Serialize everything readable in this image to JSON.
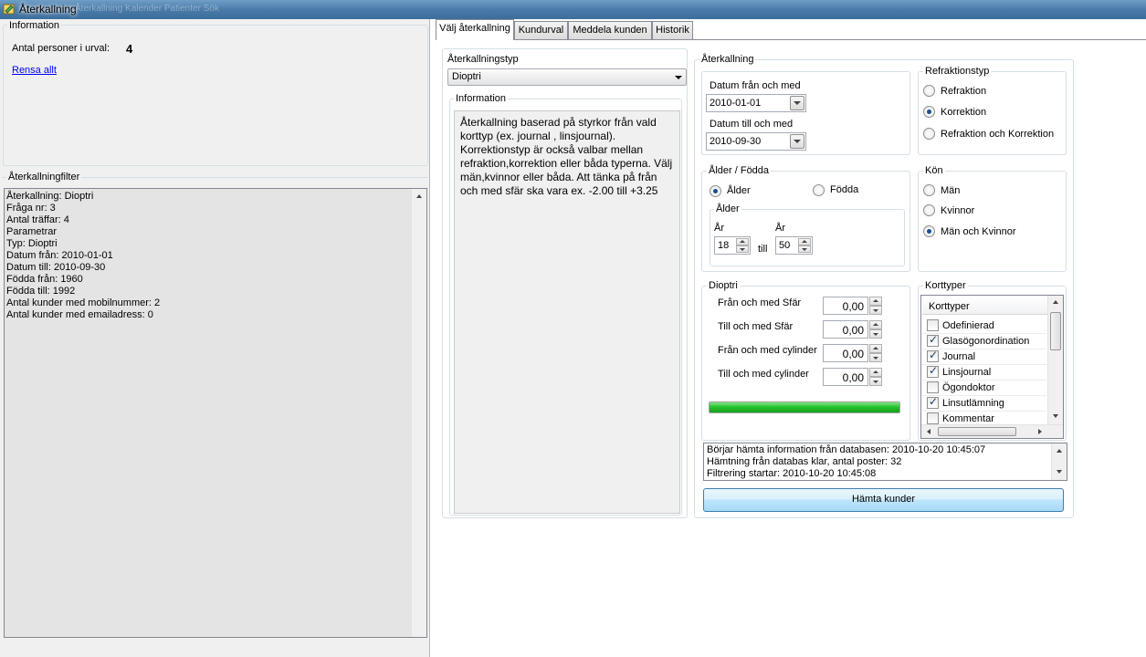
{
  "window": {
    "title": "Återkallning",
    "ghost_title": "Återkallning Kalender Patienter Sök"
  },
  "left": {
    "info_legend": "Information",
    "count_label": "Antal personer i urval:",
    "count_value": "4",
    "clear_link": "Rensa allt",
    "filter_legend": "Återkallningfilter",
    "filter_lines": [
      "Återkallning: Dioptri",
      "Fråga nr: 3",
      "Antal träffar: 4",
      "Parametrar",
      "Typ: Dioptri",
      "Datum från: 2010-01-01",
      "Datum till: 2010-09-30",
      "Födda från: 1960",
      "Födda till: 1992",
      "Antal kunder med mobilnummer: 2",
      "Antal kunder med emailadress: 0"
    ]
  },
  "tabs": [
    "Välj återkallning",
    "Kundurval",
    "Meddela kunden",
    "Historik"
  ],
  "left_col": {
    "type_label": "Återkallningstyp",
    "type_value": "Dioptri",
    "info_legend": "Information",
    "info_text": "Återkallning baserad på styrkor från vald korttyp (ex. journal , linsjournal). Korrektionstyp är också valbar mellan refraktion,korrektion eller båda typerna. Välj män,kvinnor eller båda. Att tänka på från och med sfär ska vara ex. -2.00 till +3.25"
  },
  "recall": {
    "legend": "Återkallning",
    "date_from_label": "Datum från och med",
    "date_from": "2010-01-01",
    "date_to_label": "Datum till och med",
    "date_to": "2010-09-30",
    "refr_legend": "Refraktionstyp",
    "refr_options": [
      "Refraktion",
      "Korrektion",
      "Refraktion och Korrektion"
    ],
    "refr_selected": 1,
    "age_legend": "Ålder / Födda",
    "age_opt1": "Ålder",
    "age_opt2": "Födda",
    "age_inner_legend": "Ålder",
    "year_label1": "År",
    "year_label2": "År",
    "age_from": "18",
    "age_to": "50",
    "till": "till",
    "sex_legend": "Kön",
    "sex_options": [
      "Män",
      "Kvinnor",
      "Män och Kvinnor"
    ],
    "sex_selected": 2,
    "diopt_legend": "Dioptri",
    "diopt_rows": [
      {
        "label": "Från och med Sfär",
        "value": "0,00"
      },
      {
        "label": "Till och med Sfär",
        "value": "0,00"
      },
      {
        "label": "Från och med cylinder",
        "value": "0,00"
      },
      {
        "label": "Till och med cylinder",
        "value": "0,00"
      }
    ],
    "progress_fraction": 1.0,
    "progress_color": "#22c02a",
    "card_legend": "Korttyper",
    "card_header": "Korttyper",
    "cards": [
      {
        "label": "Odefinierad",
        "checked": false
      },
      {
        "label": "Glasögonordination",
        "checked": true
      },
      {
        "label": "Journal",
        "checked": true
      },
      {
        "label": "Linsjournal",
        "checked": true
      },
      {
        "label": "Ögondoktor",
        "checked": false
      },
      {
        "label": "Linsutlämning",
        "checked": true
      },
      {
        "label": "Kommentar",
        "checked": false
      }
    ],
    "log_lines": [
      "Börjar hämta information från databasen: 2010-10-20 10:45:07",
      "Hämtning från databas klar, antal poster: 32",
      "Filtrering startar: 2010-10-20 10:45:08"
    ],
    "fetch_button": "Hämta kunder"
  }
}
